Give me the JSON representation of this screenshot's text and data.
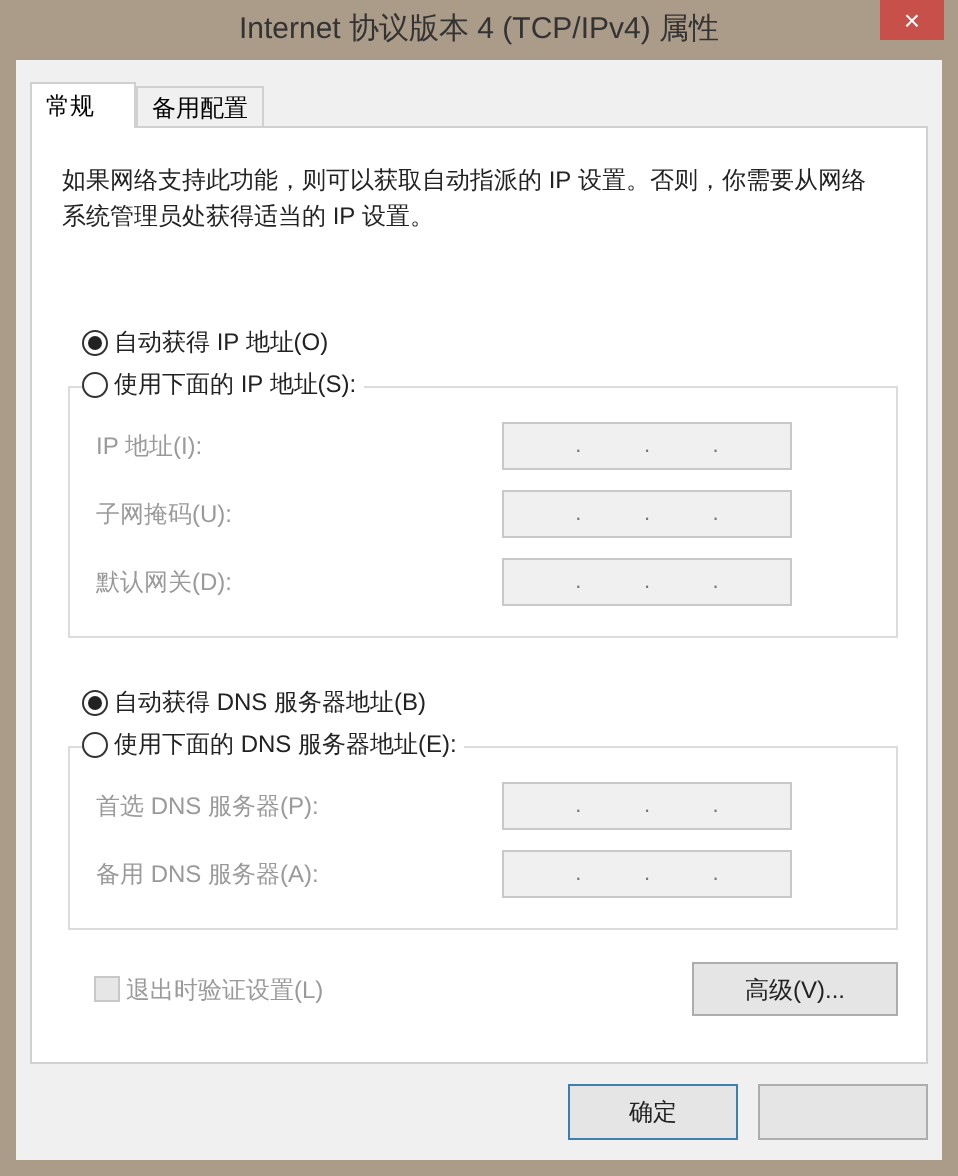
{
  "window": {
    "title": "Internet 协议版本 4 (TCP/IPv4) 属性",
    "close": "×"
  },
  "tabs": [
    {
      "label": "常规",
      "selected": true
    },
    {
      "label": "备用配置",
      "selected": false
    }
  ],
  "description": "如果网络支持此功能，则可以获取自动指派的 IP 设置。否则，你需要从网络系统管理员处获得适当的 IP 设置。",
  "sections": [
    {
      "auto_option": {
        "label": "自动获得 IP 地址(O)",
        "selected": true
      },
      "manual_option": {
        "label": "使用下面的 IP 地址(S):",
        "selected": false
      },
      "fields": [
        {
          "label": "IP 地址(I):",
          "dots": [
            ".",
            ".",
            "."
          ],
          "disabled": true
        },
        {
          "label": "子网掩码(U):",
          "dots": [
            ".",
            ".",
            "."
          ],
          "disabled": true
        },
        {
          "label": "默认网关(D):",
          "dots": [
            ".",
            ".",
            "."
          ],
          "disabled": true
        }
      ]
    },
    {
      "auto_option": {
        "label": "自动获得 DNS 服务器地址(B)",
        "selected": true
      },
      "manual_option": {
        "label": "使用下面的 DNS 服务器地址(E):",
        "selected": false
      },
      "fields": [
        {
          "label": "首选 DNS 服务器(P):",
          "dots": [
            ".",
            ".",
            "."
          ],
          "disabled": true
        },
        {
          "label": "备用 DNS 服务器(A):",
          "dots": [
            ".",
            ".",
            "."
          ],
          "disabled": true
        }
      ]
    }
  ],
  "validate": {
    "label": "退出时验证设置(L)",
    "checked": false,
    "disabled": true
  },
  "advanced_button": "高级(V)...",
  "ok_button": "确定"
}
